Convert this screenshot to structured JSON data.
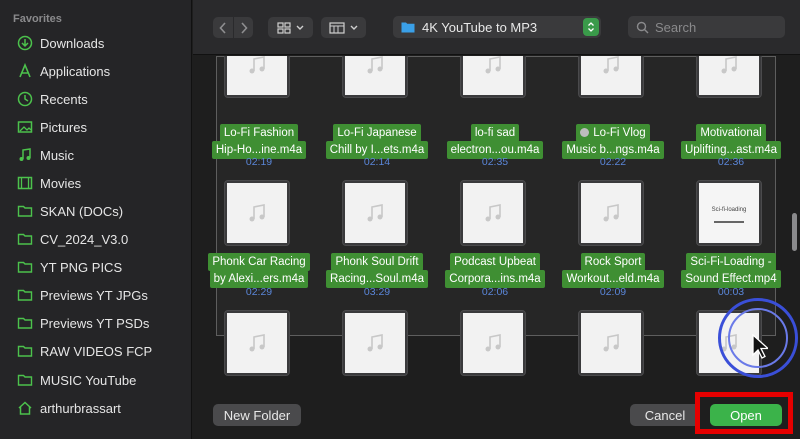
{
  "sidebar": {
    "heading": "Favorites",
    "items": [
      {
        "label": "Downloads",
        "icon": "download-icon"
      },
      {
        "label": "Applications",
        "icon": "applications-icon"
      },
      {
        "label": "Recents",
        "icon": "clock-icon"
      },
      {
        "label": "Pictures",
        "icon": "pictures-icon"
      },
      {
        "label": "Music",
        "icon": "music-icon"
      },
      {
        "label": "Movies",
        "icon": "movies-icon"
      },
      {
        "label": "SKAN (DOCs)",
        "icon": "folder-icon"
      },
      {
        "label": "CV_2024_V3.0",
        "icon": "folder-icon"
      },
      {
        "label": "YT PNG PICS",
        "icon": "folder-icon"
      },
      {
        "label": "Previews YT JPGs",
        "icon": "folder-icon"
      },
      {
        "label": "Previews YT PSDs",
        "icon": "folder-icon"
      },
      {
        "label": "RAW VIDEOS FCP",
        "icon": "folder-icon"
      },
      {
        "label": "MUSIC YouTube",
        "icon": "folder-icon"
      },
      {
        "label": "arthurbrassart",
        "icon": "home-icon"
      }
    ]
  },
  "toolbar": {
    "path": "4K YouTube to MP3",
    "search_placeholder": "Search"
  },
  "files": [
    {
      "line1": "Lo-Fi Fashion",
      "line2": "Hip-Ho...ine.m4a",
      "duration": "02:19"
    },
    {
      "line1": "Lo-Fi Japanese",
      "line2": "Chill by I...ets.m4a",
      "duration": "02:14"
    },
    {
      "line1": "lo-fi sad",
      "line2": "electron...ou.m4a",
      "duration": "02:35"
    },
    {
      "line1": "Lo-Fi Vlog",
      "line2": "Music b...ngs.m4a",
      "duration": "02:22"
    },
    {
      "line1": "Motivational",
      "line2": "Uplifting...ast.m4a",
      "duration": "02:36"
    },
    {
      "line1": "Phonk Car Racing",
      "line2": "by Alexi...ers.m4a",
      "duration": "02:29"
    },
    {
      "line1": "Phonk Soul Drift",
      "line2": "Racing...Soul.m4a",
      "duration": "03:29"
    },
    {
      "line1": "Podcast Upbeat",
      "line2": "Corpora...ins.m4a",
      "duration": "02:06"
    },
    {
      "line1": "Rock Sport",
      "line2": "Workout...eld.m4a",
      "duration": "02:09"
    },
    {
      "line1": "Sci-Fi-Loading -",
      "line2": "Sound Effect.mp4",
      "duration": "00:03",
      "preview_text": "Sci-fi-loading"
    }
  ],
  "buttons": {
    "new_folder": "New Folder",
    "cancel": "Cancel",
    "open": "Open"
  },
  "colors": {
    "accent_green": "#3bb34a",
    "selection_green": "#3f8f33",
    "highlight_red": "#e60000"
  }
}
